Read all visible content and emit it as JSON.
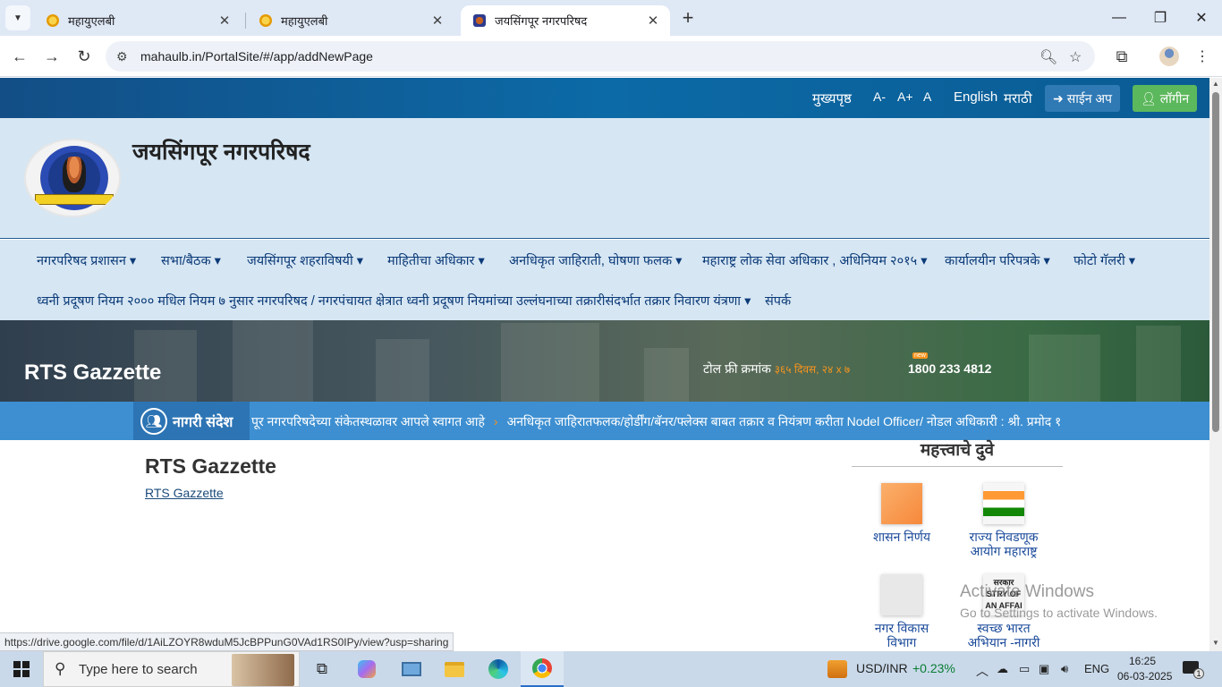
{
  "browser": {
    "tabs": [
      {
        "title": "महायुएलबी",
        "favicon_color": "#f5b400"
      },
      {
        "title": "महायुएलबी",
        "favicon_color": "#f5b400"
      },
      {
        "title": "जयसिंगपूर नगरपरिषद",
        "favicon_color": "#c7601f"
      }
    ],
    "url": "mahaulb.in/PortalSite/#/app/addNewPage",
    "status_url": "https://drive.google.com/file/d/1AiLZOYR8wduM5JcBPPunG0VAd1RS0IPy/view?usp=sharing"
  },
  "topbar": {
    "home": "मुख्यपृष्ठ",
    "font_small": "A-",
    "font_large": "A+",
    "font_normal": "A",
    "lang_en": "English",
    "lang_mr": "मराठी",
    "signup": "साईन अप",
    "login": "लॉगीन"
  },
  "header": {
    "site_title": "जयसिंगपूर नगरपरिषद"
  },
  "nav": [
    "नगरपरिषद प्रशासन",
    "सभा/बैठक",
    "जयसिंगपूर शहराविषयी",
    "माहितीचा अधिकार",
    "अनधिकृत जाहिराती, घोषणा फलक",
    "महाराष्ट्र लोक सेवा अधिकार , अधिनियम २०१५",
    "कार्यालयीन परिपत्रके",
    "फोटो गॅलरी",
    "ध्वनी प्रदूषण नियम २००० मधिल नियम ७ नुसार नगरपरिषद / नगरपंचायत क्षेत्रात ध्वनी प्रदूषण नियमांच्या उल्लंघनाच्या तक्रारीसंदर्भात तक्रार निवारण यंत्रणा",
    "संपर्क"
  ],
  "banner": {
    "title": "RTS Gazzette",
    "toll_label": "टोल फ्री क्रमांक",
    "toll_highlight": "३६५ दिवस, २४ x ७",
    "badge": "new",
    "toll_number": "1800 233 4812"
  },
  "ticker": {
    "label": "नागरी संदेश",
    "items": [
      "पूर नगरपरिषदेच्या संकेतस्थळावर आपले स्वागत आहे",
      "अनधिकृत जाहिरातफलक/होर्डींग/बॅनर/फ्लेक्स बाबत तक्रार व नियंत्रण करीता Nodel Officer/ नोडल अधिकारी : श्री. प्रमोद १"
    ],
    "separator": "›"
  },
  "content": {
    "heading": "RTS Gazzette",
    "link": "RTS Gazzette"
  },
  "important_links": {
    "title": "महत्त्वाचे दुवे",
    "tiles": [
      {
        "label": "शासन निर्णय",
        "color": "#f9a05a"
      },
      {
        "label": "राज्य निवडणूक आयोग महाराष्ट्र",
        "color": "#138808"
      },
      {
        "label": "नगर विकास विभाग",
        "color": "#e6e6e6"
      },
      {
        "label": "स्वच्छ भारत अभियान -नागरी",
        "color": "#333333"
      }
    ],
    "swachh_image_text_1": "सरकार",
    "swachh_image_text_2": "STRY OF",
    "swachh_image_text_3": "AN AFFAI"
  },
  "watermark": {
    "line1": "Activate Windows",
    "line2": "Go to Settings to activate Windows."
  },
  "taskbar": {
    "search_placeholder": "Type here to search",
    "currency": "USD/INR",
    "currency_change": "+0.23%",
    "lang": "ENG",
    "time": "16:25",
    "date": "06-03-2025",
    "notification_count": "1"
  }
}
